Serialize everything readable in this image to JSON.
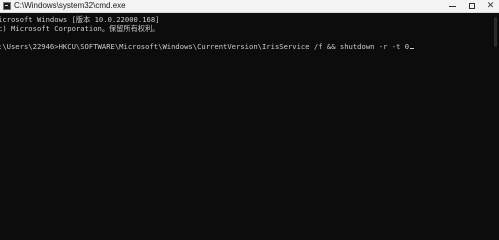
{
  "window": {
    "title": "C:\\Windows\\system32\\cmd.exe",
    "close_glyph": "✕"
  },
  "console": {
    "line1": "icrosoft Windows [版本 10.0.22000.168]",
    "line2": "c) Microsoft Corporation。保留所有权利。",
    "prompt": ":\\Users\\22946>",
    "command": "HKCU\\SOFTWARE\\Microsoft\\Windows\\CurrentVersion\\IrisService /f && shutdown -r -t 0"
  },
  "colors": {
    "console_bg": "#0c0c0c",
    "console_text": "#cccccc",
    "titlebar_bg": "#f3f3f3"
  },
  "icons": [
    "cmd-app-icon",
    "minimize-icon",
    "maximize-icon",
    "close-icon"
  ]
}
